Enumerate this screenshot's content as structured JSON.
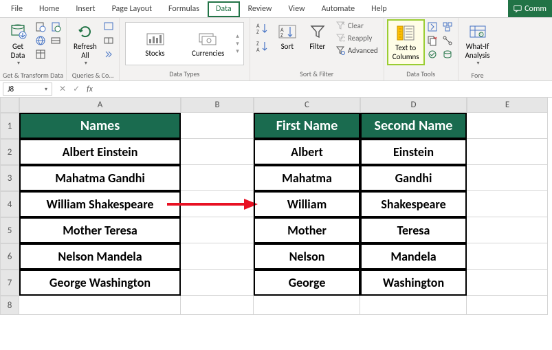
{
  "tabs": {
    "file": "File",
    "home": "Home",
    "insert": "Insert",
    "page_layout": "Page Layout",
    "formulas": "Formulas",
    "data": "Data",
    "review": "Review",
    "view": "View",
    "automate": "Automate",
    "help": "Help",
    "comments": "Comm"
  },
  "ribbon": {
    "get_data": "Get\nData",
    "get_transform": "Get & Transform Data",
    "refresh_all": "Refresh\nAll",
    "queries": "Queries & Co…",
    "stocks": "Stocks",
    "currencies": "Currencies",
    "data_types": "Data Types",
    "sort": "Sort",
    "filter": "Filter",
    "clear": "Clear",
    "reapply": "Reapply",
    "advanced": "Advanced",
    "sort_filter": "Sort & Filter",
    "text_to_columns": "Text to\nColumns",
    "data_tools": "Data Tools",
    "whatif": "What-If\nAnalysis",
    "fore": "Fore"
  },
  "namebox": "J8",
  "columns": [
    "A",
    "B",
    "C",
    "D",
    "E"
  ],
  "rows": [
    "1",
    "2",
    "3",
    "4",
    "5",
    "6",
    "7",
    "8"
  ],
  "sheet": {
    "a1": "Names",
    "c1": "First Name",
    "d1": "Second Name",
    "a": [
      "Albert Einstein",
      "Mahatma Gandhi",
      "William Shakespeare",
      "Mother Teresa",
      "Nelson Mandela",
      "George Washington"
    ],
    "c": [
      "Albert",
      "Mahatma",
      "William",
      "Mother",
      "Nelson",
      "George"
    ],
    "d": [
      "Einstein",
      "Gandhi",
      "Shakespeare",
      "Teresa",
      "Mandela",
      "Washington"
    ]
  }
}
